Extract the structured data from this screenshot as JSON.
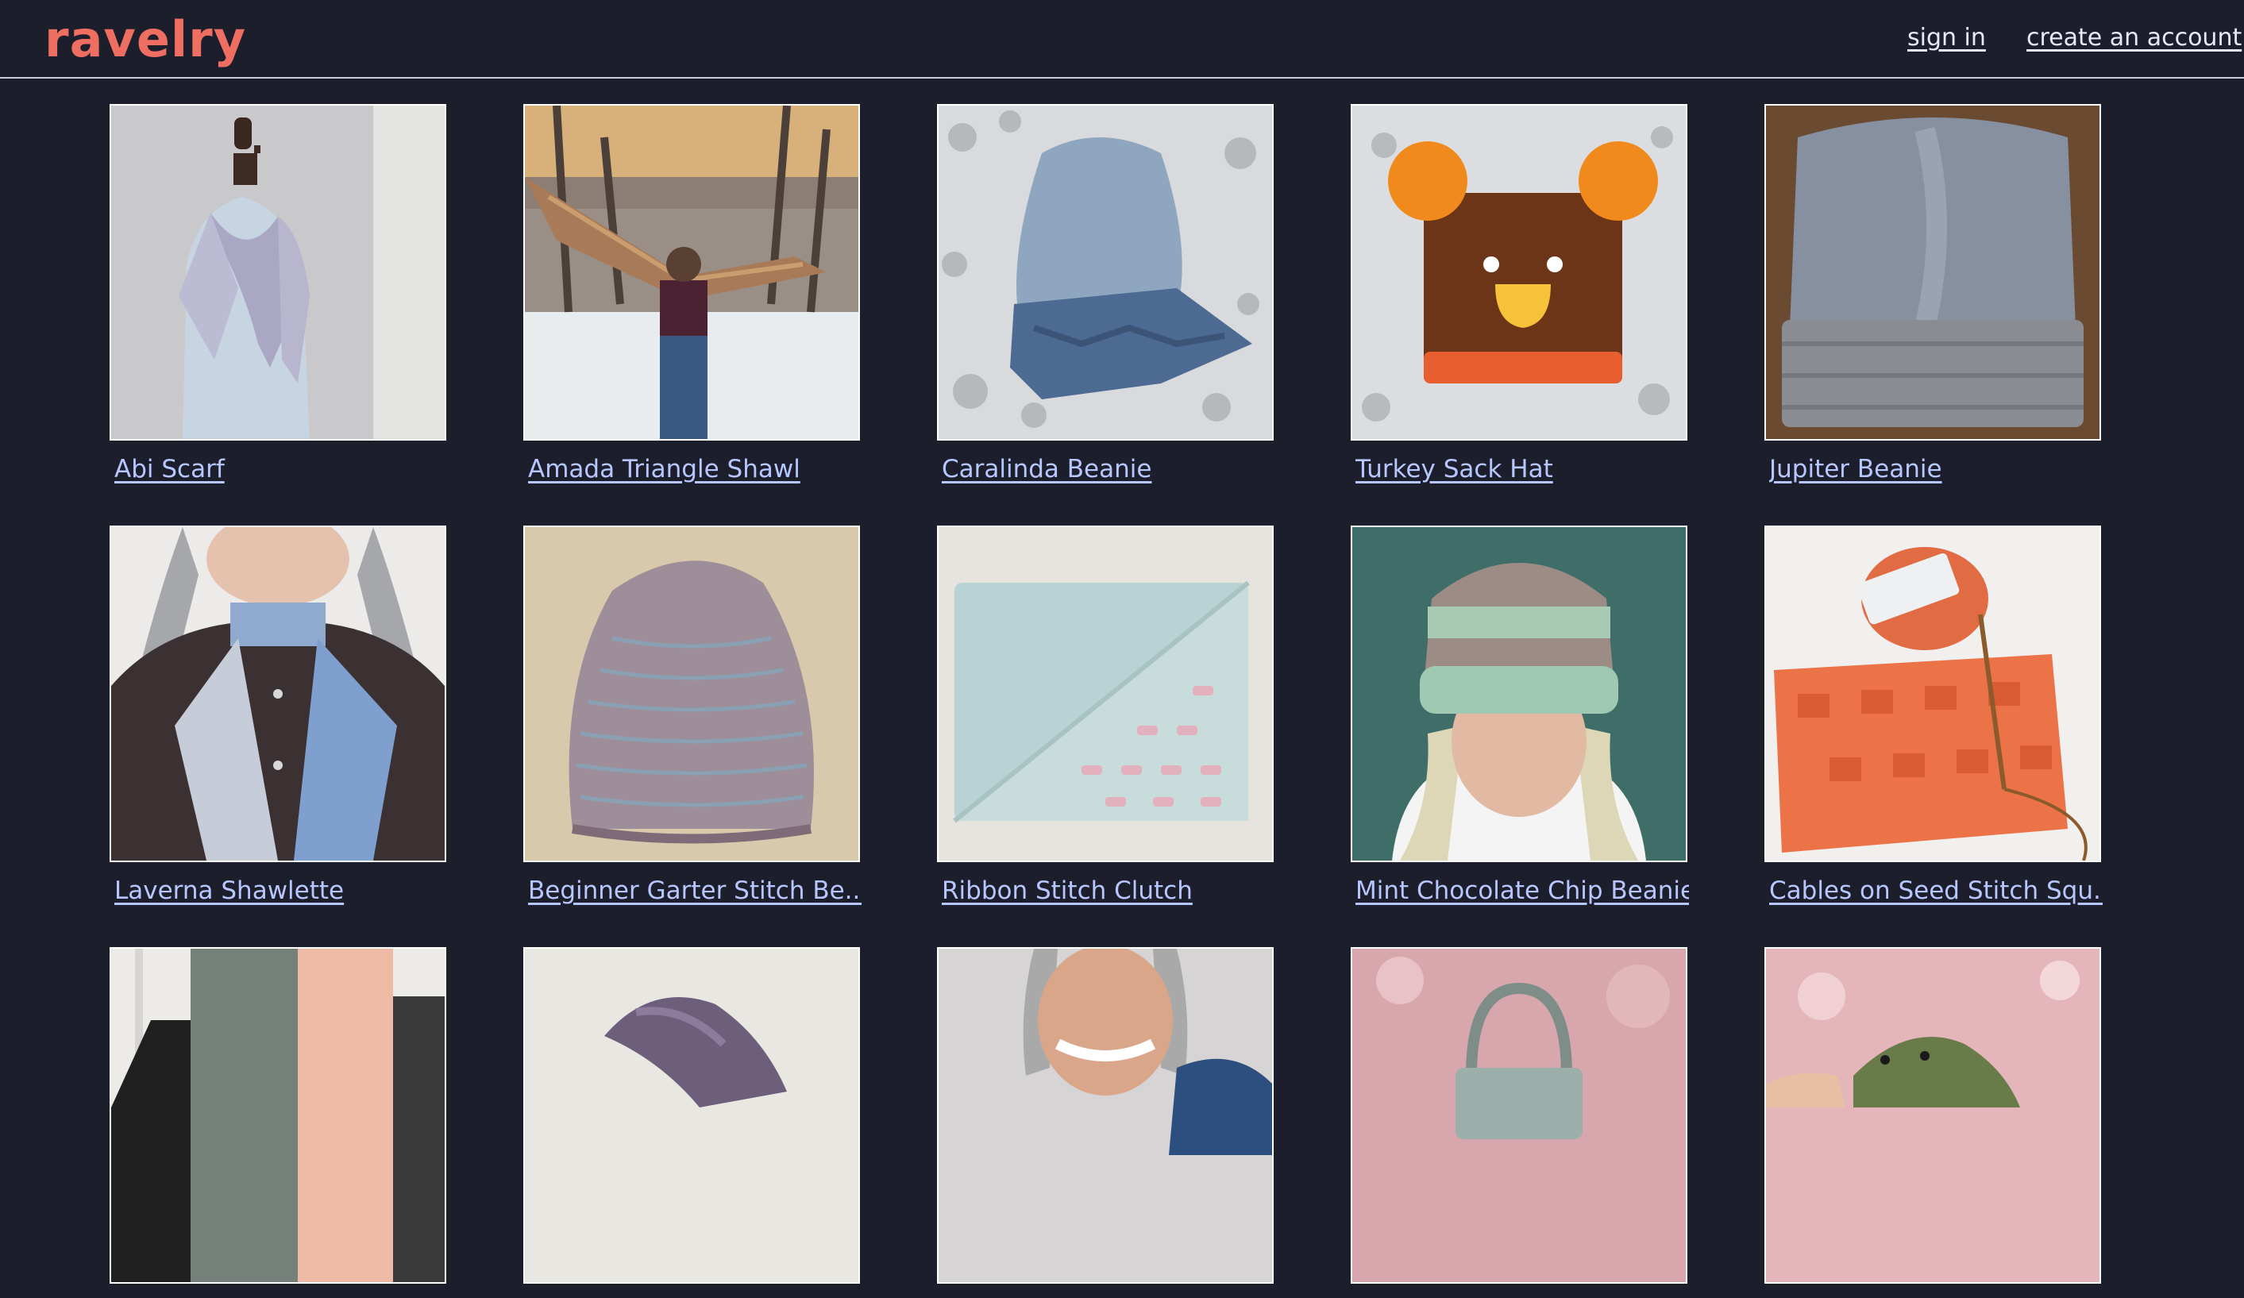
{
  "header": {
    "logo_text": "ravelry",
    "sign_in": "sign in",
    "create_account": "create an account"
  },
  "patterns": [
    {
      "title": "Abi Scarf",
      "image": "scarf-on-mannequin"
    },
    {
      "title": "Amada Triangle Shawl",
      "image": "shawl-in-snowy-woods"
    },
    {
      "title": "Caralinda Beanie",
      "image": "blue-cabled-beanie"
    },
    {
      "title": "Turkey Sack Hat",
      "image": "brown-turkey-hat"
    },
    {
      "title": "Jupiter Beanie",
      "image": "gray-cabled-beanie"
    },
    {
      "title": "Laverna Shawlette",
      "image": "blue-shawlette-on-woman"
    },
    {
      "title": "Beginner Garter Stitch Be...",
      "image": "garter-stitch-beanie"
    },
    {
      "title": "Ribbon Stitch Clutch",
      "image": "mint-ribbon-clutch"
    },
    {
      "title": "Mint Chocolate Chip Beanie",
      "image": "striped-beanie-on-woman"
    },
    {
      "title": "Cables on Seed Stitch Squ...",
      "image": "orange-swatch-with-yarn"
    },
    {
      "title": "",
      "image": "gray-peach-scarf"
    },
    {
      "title": "",
      "image": "purple-twisted-yarn"
    },
    {
      "title": "",
      "image": "woman-with-blue-cowl"
    },
    {
      "title": "",
      "image": "mini-knit-bag"
    },
    {
      "title": "",
      "image": "green-knit-toy"
    }
  ]
}
